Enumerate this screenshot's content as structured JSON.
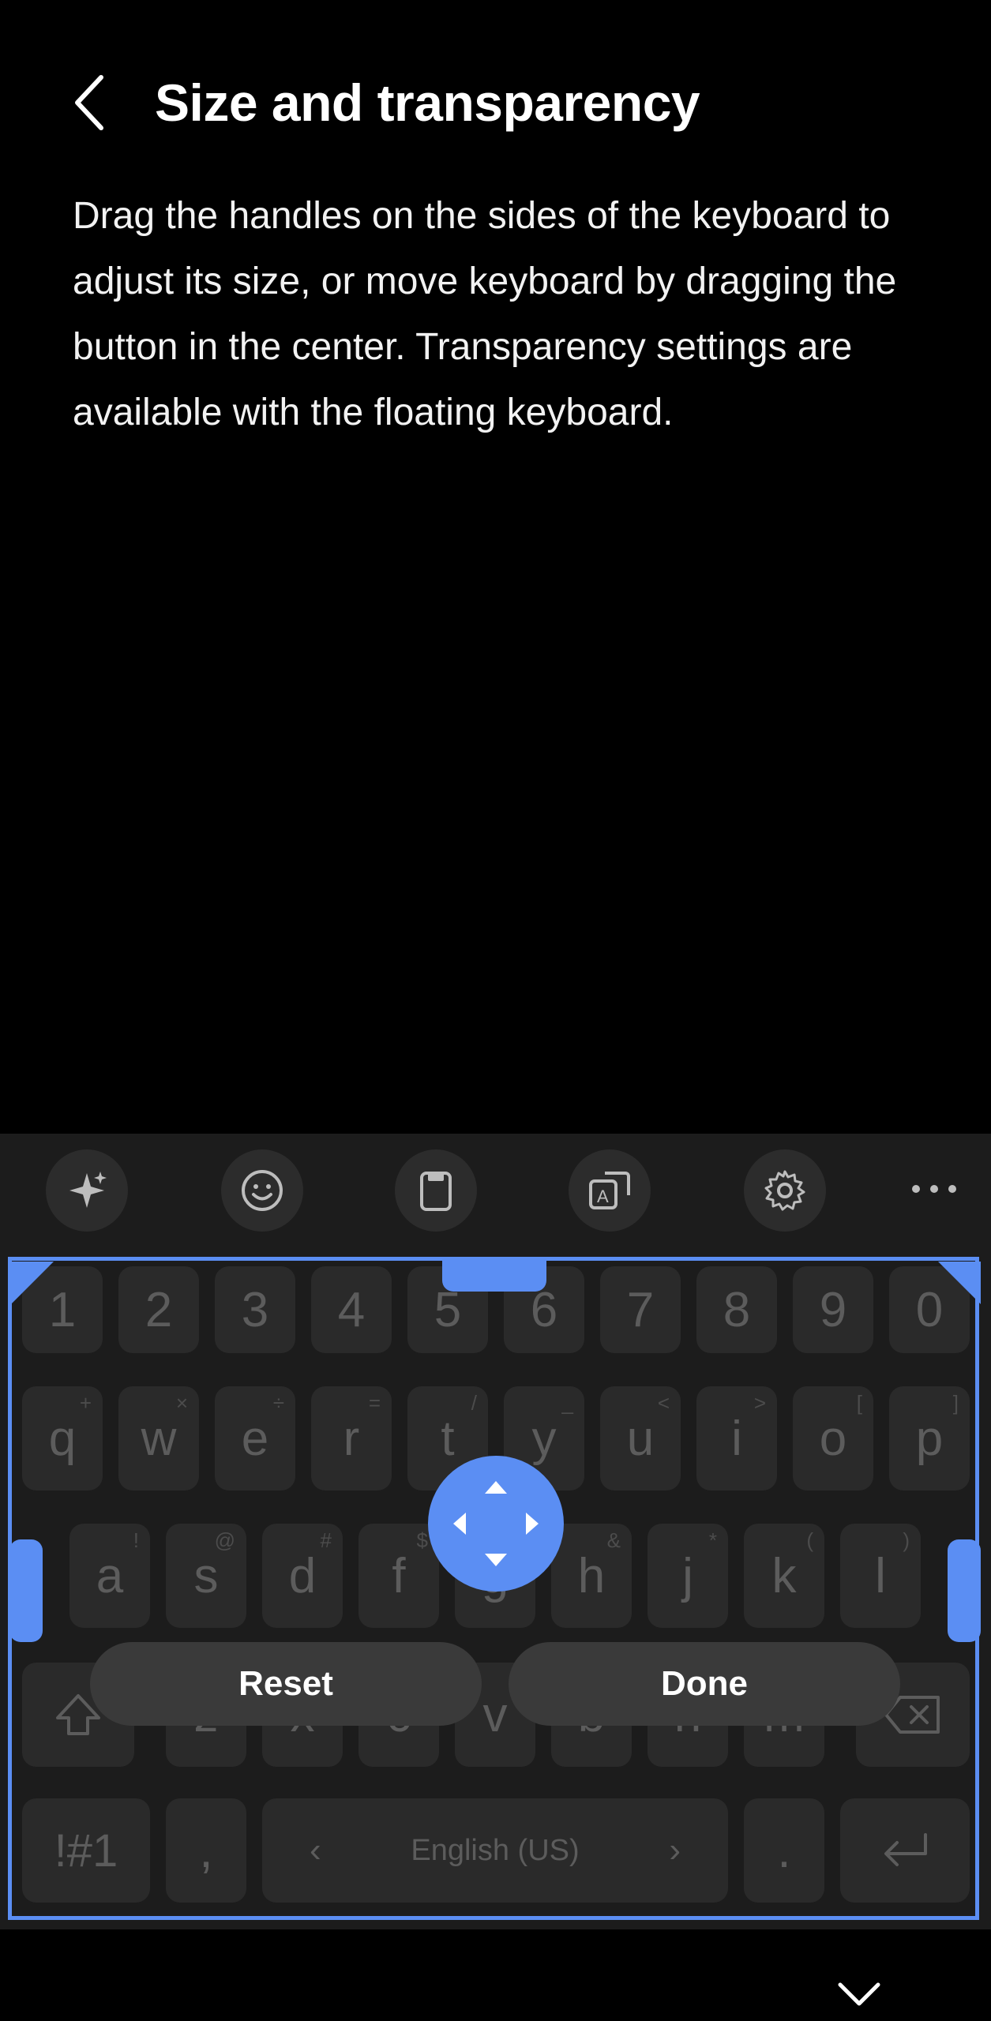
{
  "header": {
    "title": "Size and transparency",
    "description": "Drag the handles on the sides of the keyboard to adjust its size, or move keyboard by dragging the button in the center. Transparency settings are available with the floating keyboard."
  },
  "toolbar": {
    "icons": [
      "ai-sparkle-icon",
      "emoji-icon",
      "clipboard-icon",
      "translate-icon",
      "settings-gear-icon",
      "more-icon"
    ]
  },
  "keyboard": {
    "number_row": [
      "1",
      "2",
      "3",
      "4",
      "5",
      "6",
      "7",
      "8",
      "9",
      "0"
    ],
    "row1": [
      {
        "key": "q",
        "hint": "+"
      },
      {
        "key": "w",
        "hint": "×"
      },
      {
        "key": "e",
        "hint": "÷"
      },
      {
        "key": "r",
        "hint": "="
      },
      {
        "key": "t",
        "hint": "/"
      },
      {
        "key": "y",
        "hint": "_"
      },
      {
        "key": "u",
        "hint": "<"
      },
      {
        "key": "i",
        "hint": ">"
      },
      {
        "key": "o",
        "hint": "["
      },
      {
        "key": "p",
        "hint": "]"
      }
    ],
    "row2": [
      {
        "key": "a",
        "hint": "!"
      },
      {
        "key": "s",
        "hint": "@"
      },
      {
        "key": "d",
        "hint": "#"
      },
      {
        "key": "f",
        "hint": "$"
      },
      {
        "key": "g",
        "hint": "%"
      },
      {
        "key": "h",
        "hint": "&"
      },
      {
        "key": "j",
        "hint": "*"
      },
      {
        "key": "k",
        "hint": "("
      },
      {
        "key": "l",
        "hint": ")"
      }
    ],
    "row3": [
      "z",
      "x",
      "c",
      "v",
      "b",
      "n",
      "m"
    ],
    "symbols_key": "!#1",
    "comma_key": ",",
    "space_label": "English (US)",
    "period_key": "."
  },
  "buttons": {
    "reset": "Reset",
    "done": "Done"
  },
  "colors": {
    "accent": "#5b8ef3",
    "background": "#000000",
    "keyboard_bg": "#1c1c1c",
    "key_bg": "#2a2a2a"
  }
}
